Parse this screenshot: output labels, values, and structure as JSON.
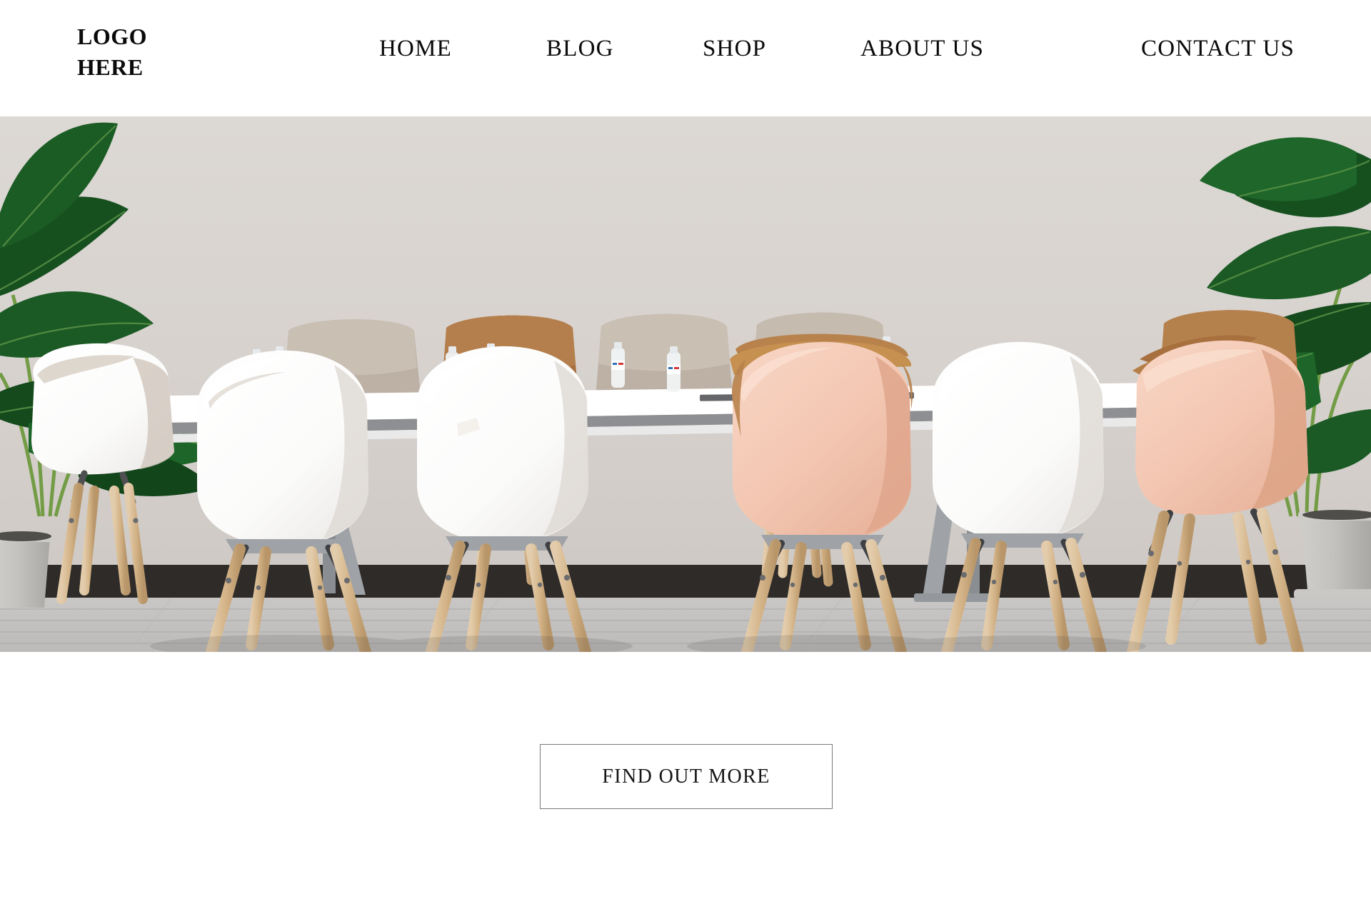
{
  "header": {
    "logo_text": "LOGO\nHERE",
    "nav": [
      {
        "label": "HOME"
      },
      {
        "label": "BLOG"
      },
      {
        "label": "SHOP"
      },
      {
        "label": "ABOUT US"
      },
      {
        "label": "CONTACT US"
      }
    ]
  },
  "hero": {
    "alt": "modern-meeting-room-with-white-and-pink-chairs-long-white-table-water-bottles-and-two-large-banana-leaf-plants",
    "colors": {
      "wall": "#d8d3cf",
      "wall_light": "#dedad6",
      "baseboard": "#2e2b29",
      "floor": "#cfcdcb",
      "floor_dark": "#b9b7b5",
      "chair_white": "#fdfdfd",
      "chair_pink": "#f3c8b4",
      "chair_pink_dark": "#e8b39c",
      "cushion_beige": "#bdb2a6",
      "cushion_tan": "#a8703e",
      "wood_leg": "#d9bd96",
      "wood_leg_dark": "#b9955f",
      "metal_dark": "#55565a",
      "metal_mid": "#9fa2a6",
      "table_top": "#ffffff",
      "table_edge": "#8d8f92",
      "pot_grey": "#c2c1be",
      "leaf_dark": "#14461f",
      "leaf_mid": "#1d5c28",
      "leaf_light": "#2c7a38",
      "bottle_blue": "#2f6fb5",
      "bottle_red": "#cf3a3a"
    }
  },
  "cta": {
    "label": "FIND OUT MORE",
    "border_color": "#7a7a7a"
  }
}
